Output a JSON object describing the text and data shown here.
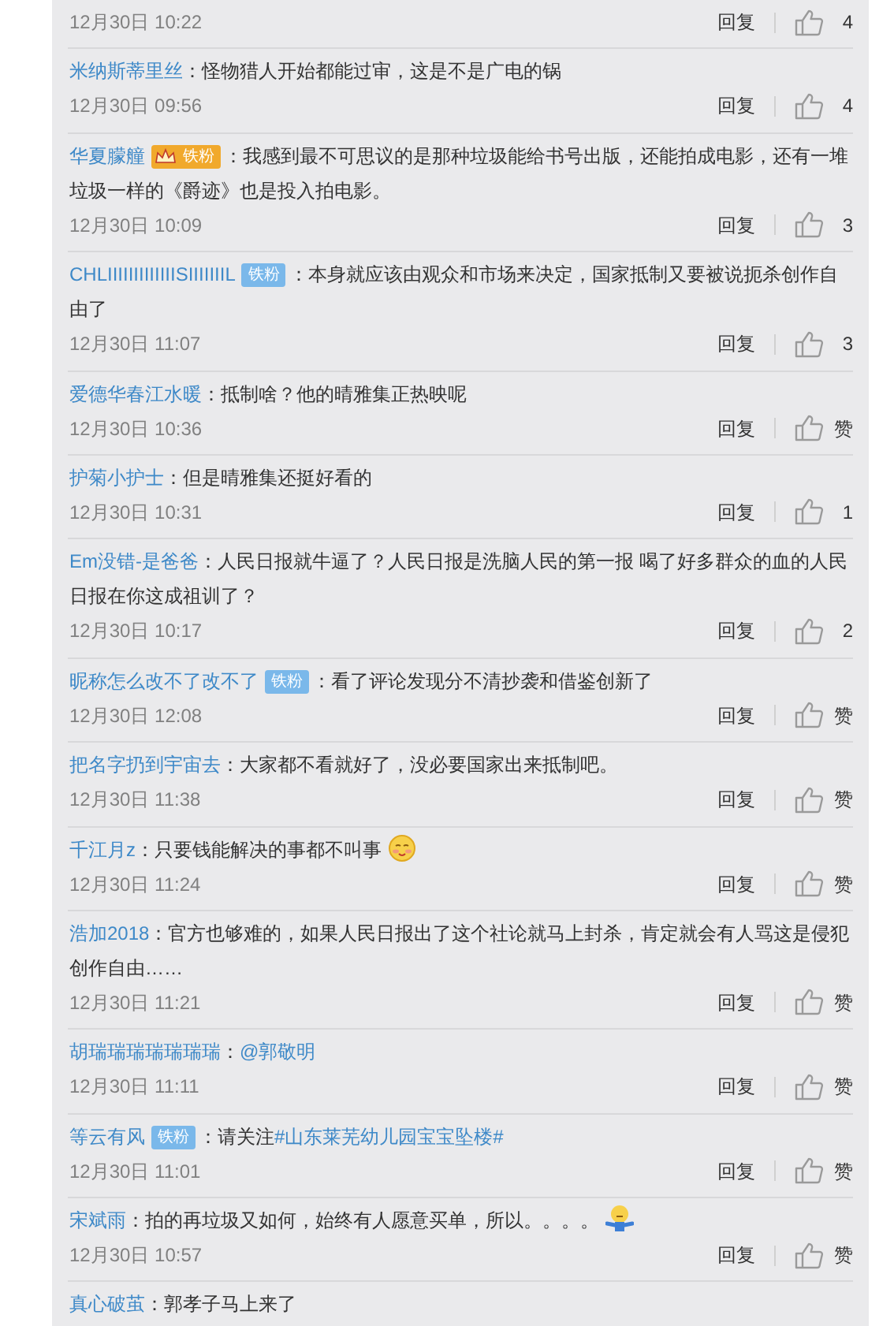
{
  "comments": [
    {
      "date": "12月30日 10:22",
      "reply": "回复",
      "likes": "4"
    },
    {
      "user": "米纳斯蒂里丝",
      "text": [
        {
          "kind": "text",
          "text": "：怪物猎人开始都能过审，这是不是广电的锅"
        }
      ],
      "date": "12月30日 09:56",
      "reply": "回复",
      "likes": "4"
    },
    {
      "user": "华夏朦艟",
      "badge": {
        "kind": "vip",
        "label": "铁粉"
      },
      "text": [
        {
          "kind": "text",
          "text": "：我感到最不可思议的是那种垃圾能给书号出版，还能拍成电影，还有一堆垃圾一样的《爵迹》也是投入拍电影。"
        }
      ],
      "date": "12月30日 10:09",
      "reply": "回复",
      "likes": "3"
    },
    {
      "user": "CHLIIIIIIIIIIIIISIIIIIIIL",
      "badge": {
        "kind": "fan",
        "label": "铁粉"
      },
      "text": [
        {
          "kind": "text",
          "text": "：本身就应该由观众和市场来决定，国家抵制又要被说扼杀创作自由了"
        }
      ],
      "date": "12月30日 11:07",
      "reply": "回复",
      "likes": "3"
    },
    {
      "user": "爱德华春江水暖",
      "text": [
        {
          "kind": "text",
          "text": "：抵制啥？他的晴雅集正热映呢"
        }
      ],
      "date": "12月30日 10:36",
      "reply": "回复",
      "likes": "赞"
    },
    {
      "user": "护菊小护士",
      "text": [
        {
          "kind": "text",
          "text": "：但是晴雅集还挺好看的"
        }
      ],
      "date": "12月30日 10:31",
      "reply": "回复",
      "likes": "1"
    },
    {
      "user": "Em没错-是爸爸",
      "text": [
        {
          "kind": "text",
          "text": "：人民日报就牛逼了？人民日报是洗脑人民的第一报 喝了好多群众的血的人民日报在你这成祖训了？"
        }
      ],
      "date": "12月30日 10:17",
      "reply": "回复",
      "likes": "2"
    },
    {
      "user": "昵称怎么改不了改不了",
      "badge": {
        "kind": "fan",
        "label": "铁粉"
      },
      "text": [
        {
          "kind": "text",
          "text": "：看了评论发现分不清抄袭和借鉴创新了"
        }
      ],
      "date": "12月30日 12:08",
      "reply": "回复",
      "likes": "赞"
    },
    {
      "user": "把名字扔到宇宙去",
      "text": [
        {
          "kind": "text",
          "text": "：大家都不看就好了，没必要国家出来抵制吧。"
        }
      ],
      "date": "12月30日 11:38",
      "reply": "回复",
      "likes": "赞"
    },
    {
      "user": "千江月z",
      "text": [
        {
          "kind": "text",
          "text": "：只要钱能解决的事都不叫事"
        },
        {
          "kind": "emoji"
        }
      ],
      "date": "12月30日 11:24",
      "reply": "回复",
      "likes": "赞"
    },
    {
      "user": "浩加2018",
      "text": [
        {
          "kind": "text",
          "text": "：官方也够难的，如果人民日报出了这个社论就马上封杀，肯定就会有人骂这是侵犯创作自由……"
        }
      ],
      "date": "12月30日 11:21",
      "reply": "回复",
      "likes": "赞"
    },
    {
      "user": "胡瑞瑞瑞瑞瑞瑞瑞",
      "text": [
        {
          "kind": "text",
          "text": "："
        },
        {
          "kind": "link",
          "text": "@郭敬明"
        }
      ],
      "date": "12月30日 11:11",
      "reply": "回复",
      "likes": "赞"
    },
    {
      "user": "等云有风",
      "badge": {
        "kind": "fan",
        "label": "铁粉"
      },
      "text": [
        {
          "kind": "text",
          "text": "：请关注"
        },
        {
          "kind": "link",
          "text": "#山东莱芜幼儿园宝宝坠楼#"
        }
      ],
      "date": "12月30日 11:01",
      "reply": "回复",
      "likes": "赞"
    },
    {
      "user": "宋斌雨",
      "text": [
        {
          "kind": "text",
          "text": "：拍的再垃圾又如何，始终有人愿意买单，所以。。。。"
        },
        {
          "kind": "emoji"
        }
      ],
      "date": "12月30日 10:57",
      "reply": "回复",
      "likes": "赞"
    },
    {
      "user": "真心破茧",
      "text": [
        {
          "kind": "text",
          "text": "：郭孝子马上来了"
        }
      ]
    }
  ]
}
